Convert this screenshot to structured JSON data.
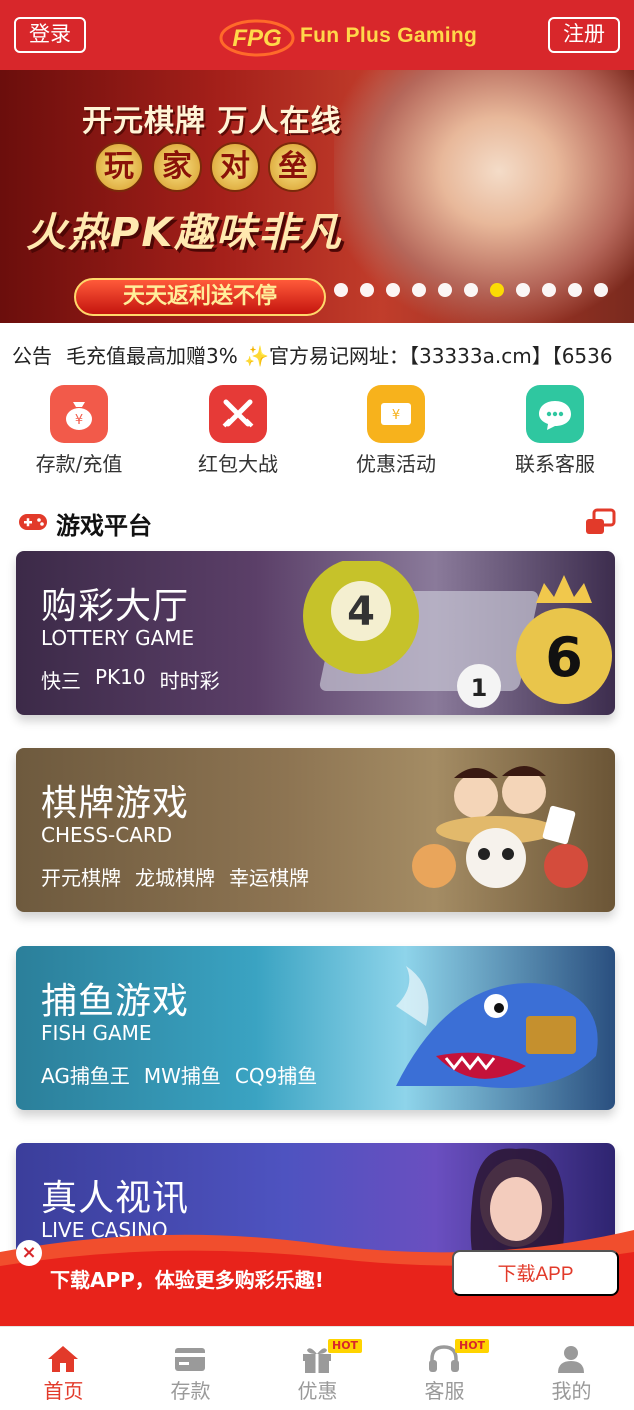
{
  "header": {
    "login_label": "登录",
    "register_label": "注册",
    "brand_mark": "FPG",
    "brand_text": "Fun Plus Gaming",
    "bg_color": "#d8272b"
  },
  "banner": {
    "line1": "开元棋牌 万人在线",
    "line2_chars": [
      "玩",
      "家",
      "对",
      "垒"
    ],
    "line3": "火热PK趣味非凡",
    "pill": "天天返利送不停",
    "dots_total": 11,
    "dots_active_index": 6
  },
  "notice": {
    "label": "公告",
    "text": "毛充值最高加赠3% ✨官方易记网址：【33333a.cm】【6536"
  },
  "quick": [
    {
      "label": "存款/充值",
      "icon": "money-bag-icon",
      "color": "#f25a4a"
    },
    {
      "label": "红包大战",
      "icon": "crossed-swords-icon",
      "color": "#e63a37"
    },
    {
      "label": "优惠活动",
      "icon": "ticket-icon",
      "color": "#f7b21c"
    },
    {
      "label": "联系客服",
      "icon": "chat-bubble-icon",
      "color": "#2fc7a0"
    }
  ],
  "section": {
    "title": "游戏平台",
    "icon": "gamepad-icon",
    "switch_icon": "switch-view-icon"
  },
  "games": [
    {
      "title": "购彩大厅",
      "subtitle": "LOTTERY GAME",
      "tags": [
        "快三",
        "PK10",
        "时时彩"
      ]
    },
    {
      "title": "棋牌游戏",
      "subtitle": "CHESS-CARD",
      "tags": [
        "开元棋牌",
        "龙城棋牌",
        "幸运棋牌"
      ]
    },
    {
      "title": "捕鱼游戏",
      "subtitle": "FISH GAME",
      "tags": [
        "AG捕鱼王",
        "MW捕鱼",
        "CQ9捕鱼"
      ]
    },
    {
      "title": "真人视讯",
      "subtitle": "LIVE CASINO",
      "tags": []
    }
  ],
  "lottery_balls": [
    "4",
    "1",
    "6"
  ],
  "download": {
    "close": "×",
    "text": "下载APP，体验更多购彩乐趣!",
    "button": "下载APP"
  },
  "tabs": [
    {
      "label": "首页",
      "icon": "home-icon",
      "active": true,
      "hot": ""
    },
    {
      "label": "存款",
      "icon": "card-icon",
      "active": false,
      "hot": ""
    },
    {
      "label": "优惠",
      "icon": "gift-icon",
      "active": false,
      "hot": "HOT"
    },
    {
      "label": "客服",
      "icon": "headset-icon",
      "active": false,
      "hot": "HOT"
    },
    {
      "label": "我的",
      "icon": "user-icon",
      "active": false,
      "hot": ""
    }
  ]
}
